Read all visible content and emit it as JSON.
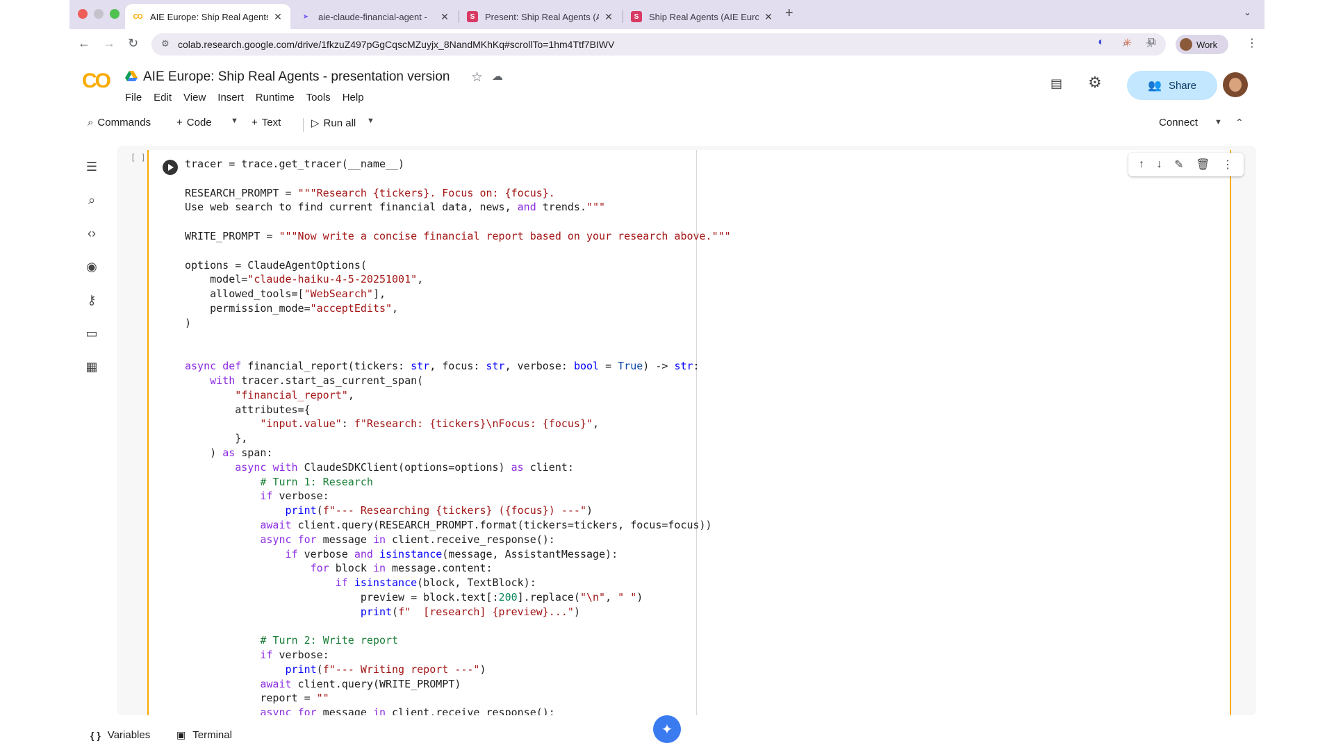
{
  "browser": {
    "tabs": [
      {
        "label": "AIE Europe: Ship Real Agents",
        "active": true
      },
      {
        "label": "aie-claude-financial-agent - ",
        "active": false
      },
      {
        "label": "Present: Ship Real Agents (A",
        "active": false
      },
      {
        "label": "Ship Real Agents (AIE Europe",
        "active": false
      }
    ],
    "url": "colab.research.google.com/drive/1fkzuZ497pGgCqscMZuyjx_8NandMKhKq#scrollTo=1hm4Ttf7BIWV",
    "profile_label": "Work"
  },
  "colab": {
    "logo": "CO",
    "title": "AIE Europe: Ship Real Agents - presentation version",
    "menu": [
      "File",
      "Edit",
      "View",
      "Insert",
      "Runtime",
      "Tools",
      "Help"
    ],
    "share_label": "Share",
    "toolbar": {
      "commands": "Commands",
      "code": "Code",
      "text": "Text",
      "run_all": "Run all",
      "connect": "Connect"
    },
    "cell_bracket": "[ ]",
    "statusbar": {
      "variables": "Variables",
      "terminal": "Terminal"
    }
  },
  "code_lines": [
    "tracer = trace.get_tracer(__name__)",
    "",
    "RESEARCH_PROMPT = \"\"\"Research {tickers}. Focus on: {focus}.",
    "Use web search to find current financial data, news, and trends.\"\"\"",
    "",
    "WRITE_PROMPT = \"\"\"Now write a concise financial report based on your research above.\"\"\"",
    "",
    "options = ClaudeAgentOptions(",
    "    model=\"claude-haiku-4-5-20251001\",",
    "    allowed_tools=[\"WebSearch\"],",
    "    permission_mode=\"acceptEdits\",",
    ")",
    "",
    "",
    "async def financial_report(tickers: str, focus: str, verbose: bool = True) -> str:",
    "    with tracer.start_as_current_span(",
    "        \"financial_report\",",
    "        attributes={",
    "            \"input.value\": f\"Research: {tickers}\\nFocus: {focus}\",",
    "        },",
    "    ) as span:",
    "        async with ClaudeSDKClient(options=options) as client:",
    "            # Turn 1: Research",
    "            if verbose:",
    "                print(f\"--- Researching {tickers} ({focus}) ---\")",
    "            await client.query(RESEARCH_PROMPT.format(tickers=tickers, focus=focus))",
    "            async for message in client.receive_response():",
    "                if verbose and isinstance(message, AssistantMessage):",
    "                    for block in message.content:",
    "                        if isinstance(block, TextBlock):",
    "                            preview = block.text[:200].replace(\"\\n\", \" \")",
    "                            print(f\"  [research] {preview}...\")",
    "",
    "            # Turn 2: Write report",
    "            if verbose:",
    "                print(f\"--- Writing report ---\")",
    "            await client.query(WRITE_PROMPT)",
    "            report = \"\"",
    "            async for message in client.receive_response():"
  ]
}
